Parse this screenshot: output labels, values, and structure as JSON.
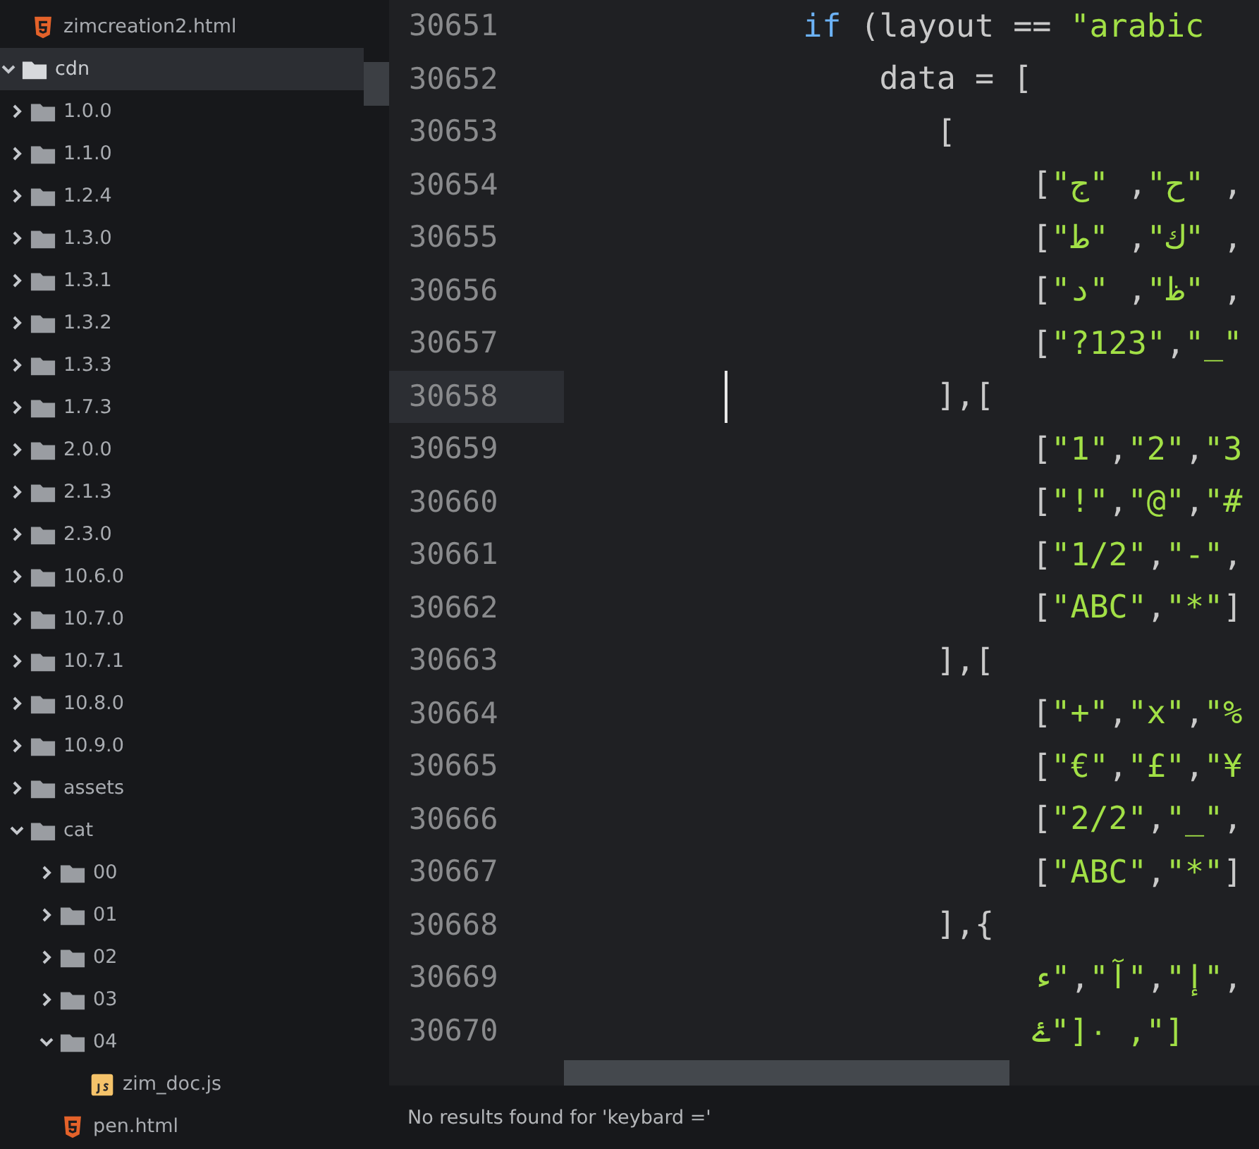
{
  "sidebar": {
    "tree": [
      {
        "children": [
          {
            "name": "zimcreation2.html",
            "kind": "html",
            "selected": false
          }
        ]
      },
      {
        "name": "cdn",
        "kind": "folder",
        "expanded": true,
        "selected": true,
        "children": [
          {
            "name": "1.0.0",
            "kind": "folder",
            "expanded": false,
            "selected": false
          },
          {
            "name": "1.1.0",
            "kind": "folder",
            "expanded": false,
            "selected": false
          },
          {
            "name": "1.2.4",
            "kind": "folder",
            "expanded": false,
            "selected": false
          },
          {
            "name": "1.3.0",
            "kind": "folder",
            "expanded": false,
            "selected": false
          },
          {
            "name": "1.3.1",
            "kind": "folder",
            "expanded": false,
            "selected": false
          },
          {
            "name": "1.3.2",
            "kind": "folder",
            "expanded": false,
            "selected": false
          },
          {
            "name": "1.3.3",
            "kind": "folder",
            "expanded": false,
            "selected": false
          },
          {
            "name": "1.7.3",
            "kind": "folder",
            "expanded": false,
            "selected": false
          },
          {
            "name": "2.0.0",
            "kind": "folder",
            "expanded": false,
            "selected": false
          },
          {
            "name": "2.1.3",
            "kind": "folder",
            "expanded": false,
            "selected": false
          },
          {
            "name": "2.3.0",
            "kind": "folder",
            "expanded": false,
            "selected": false
          },
          {
            "name": "10.6.0",
            "kind": "folder",
            "expanded": false,
            "selected": false
          },
          {
            "name": "10.7.0",
            "kind": "folder",
            "expanded": false,
            "selected": false
          },
          {
            "name": "10.7.1",
            "kind": "folder",
            "expanded": false,
            "selected": false
          },
          {
            "name": "10.8.0",
            "kind": "folder",
            "expanded": false,
            "selected": false
          },
          {
            "name": "10.9.0",
            "kind": "folder",
            "expanded": false,
            "selected": false
          },
          {
            "name": "assets",
            "kind": "folder",
            "expanded": false,
            "selected": false
          },
          {
            "name": "cat",
            "kind": "folder",
            "expanded": true,
            "selected": false,
            "children": [
              {
                "name": "00",
                "kind": "folder",
                "expanded": false,
                "selected": false
              },
              {
                "name": "01",
                "kind": "folder",
                "expanded": false,
                "selected": false
              },
              {
                "name": "02",
                "kind": "folder",
                "expanded": false,
                "selected": false
              },
              {
                "name": "03",
                "kind": "folder",
                "expanded": false,
                "selected": false
              },
              {
                "name": "04",
                "kind": "folder",
                "expanded": true,
                "selected": false,
                "children": [
                  {
                    "name": "zim_doc.js",
                    "kind": "js",
                    "selected": false
                  }
                ]
              },
              {
                "name": "pen.html",
                "kind": "html",
                "selected": false
              }
            ]
          }
        ]
      }
    ]
  },
  "editor": {
    "lines": [
      {
        "number": "30651",
        "current": false,
        "tokens": [
          {
            "kind": "keyword",
            "text": "            if"
          },
          {
            "kind": "plain",
            "text": " (layout == "
          },
          {
            "kind": "string",
            "text": "\"arabic"
          }
        ]
      },
      {
        "number": "30652",
        "current": false,
        "tokens": [
          {
            "kind": "plain",
            "text": "                data = ["
          }
        ]
      },
      {
        "number": "30653",
        "current": false,
        "tokens": [
          {
            "kind": "plain",
            "text": "                   ["
          }
        ]
      },
      {
        "number": "30654",
        "current": false,
        "tokens": [
          {
            "kind": "plain",
            "text": "                        ["
          },
          {
            "kind": "string",
            "text": "\"ج\""
          },
          {
            "kind": "plain",
            "text": " ,"
          },
          {
            "kind": "string",
            "text": "\"ح\""
          },
          {
            "kind": "plain",
            "text": " ,"
          }
        ]
      },
      {
        "number": "30655",
        "current": false,
        "tokens": [
          {
            "kind": "plain",
            "text": "                        ["
          },
          {
            "kind": "string",
            "text": "\"ط\""
          },
          {
            "kind": "plain",
            "text": " ,"
          },
          {
            "kind": "string",
            "text": "\"ك\""
          },
          {
            "kind": "plain",
            "text": " ,"
          }
        ]
      },
      {
        "number": "30656",
        "current": false,
        "tokens": [
          {
            "kind": "plain",
            "text": "                        ["
          },
          {
            "kind": "string",
            "text": "\"د\""
          },
          {
            "kind": "plain",
            "text": " ,"
          },
          {
            "kind": "string",
            "text": "\"ظ\""
          },
          {
            "kind": "plain",
            "text": " ,"
          }
        ]
      },
      {
        "number": "30657",
        "current": false,
        "tokens": [
          {
            "kind": "plain",
            "text": "                        ["
          },
          {
            "kind": "string",
            "text": "\"?123\""
          },
          {
            "kind": "plain",
            "text": ","
          },
          {
            "kind": "string",
            "text": "\"_\""
          }
        ]
      },
      {
        "number": "30658",
        "current": true,
        "tokens": [
          {
            "kind": "plain",
            "text": "                   ],["
          }
        ]
      },
      {
        "number": "30659",
        "current": false,
        "tokens": [
          {
            "kind": "plain",
            "text": "                        ["
          },
          {
            "kind": "string",
            "text": "\"1\""
          },
          {
            "kind": "plain",
            "text": ","
          },
          {
            "kind": "string",
            "text": "\"2\""
          },
          {
            "kind": "plain",
            "text": ","
          },
          {
            "kind": "string",
            "text": "\"3"
          }
        ]
      },
      {
        "number": "30660",
        "current": false,
        "tokens": [
          {
            "kind": "plain",
            "text": "                        ["
          },
          {
            "kind": "string",
            "text": "\"!\""
          },
          {
            "kind": "plain",
            "text": ","
          },
          {
            "kind": "string",
            "text": "\"@\""
          },
          {
            "kind": "plain",
            "text": ","
          },
          {
            "kind": "string",
            "text": "\"#"
          }
        ]
      },
      {
        "number": "30661",
        "current": false,
        "tokens": [
          {
            "kind": "plain",
            "text": "                        ["
          },
          {
            "kind": "string",
            "text": "\"1/2\""
          },
          {
            "kind": "plain",
            "text": ","
          },
          {
            "kind": "string",
            "text": "\"-\""
          },
          {
            "kind": "plain",
            "text": ","
          }
        ]
      },
      {
        "number": "30662",
        "current": false,
        "tokens": [
          {
            "kind": "plain",
            "text": "                        ["
          },
          {
            "kind": "string",
            "text": "\"ABC\""
          },
          {
            "kind": "plain",
            "text": ","
          },
          {
            "kind": "string",
            "text": "\"*\""
          },
          {
            "kind": "plain",
            "text": "]"
          }
        ]
      },
      {
        "number": "30663",
        "current": false,
        "tokens": [
          {
            "kind": "plain",
            "text": "                   ],["
          }
        ]
      },
      {
        "number": "30664",
        "current": false,
        "tokens": [
          {
            "kind": "plain",
            "text": "                        ["
          },
          {
            "kind": "string",
            "text": "\"+\""
          },
          {
            "kind": "plain",
            "text": ","
          },
          {
            "kind": "string",
            "text": "\"x\""
          },
          {
            "kind": "plain",
            "text": ","
          },
          {
            "kind": "string",
            "text": "\"%"
          }
        ]
      },
      {
        "number": "30665",
        "current": false,
        "tokens": [
          {
            "kind": "plain",
            "text": "                        ["
          },
          {
            "kind": "string",
            "text": "\"€\""
          },
          {
            "kind": "plain",
            "text": ","
          },
          {
            "kind": "string",
            "text": "\"£\""
          },
          {
            "kind": "plain",
            "text": ","
          },
          {
            "kind": "string",
            "text": "\"¥"
          }
        ]
      },
      {
        "number": "30666",
        "current": false,
        "tokens": [
          {
            "kind": "plain",
            "text": "                        ["
          },
          {
            "kind": "string",
            "text": "\"2/2\""
          },
          {
            "kind": "plain",
            "text": ","
          },
          {
            "kind": "string",
            "text": "\"_\""
          },
          {
            "kind": "plain",
            "text": ","
          }
        ]
      },
      {
        "number": "30667",
        "current": false,
        "tokens": [
          {
            "kind": "plain",
            "text": "                        ["
          },
          {
            "kind": "string",
            "text": "\"ABC\""
          },
          {
            "kind": "plain",
            "text": ","
          },
          {
            "kind": "string",
            "text": "\"*\""
          },
          {
            "kind": "plain",
            "text": "]"
          }
        ]
      },
      {
        "number": "30668",
        "current": false,
        "tokens": [
          {
            "kind": "plain",
            "text": "                   ],{"
          }
        ]
      },
      {
        "number": "30669",
        "current": false,
        "tokens": [
          {
            "kind": "string",
            "text": "                        ء\""
          },
          {
            "kind": "plain",
            "text": ","
          },
          {
            "kind": "string",
            "text": "\"آ\""
          },
          {
            "kind": "plain",
            "text": ","
          },
          {
            "kind": "string",
            "text": "\"إ\""
          },
          {
            "kind": "plain",
            "text": ","
          }
        ]
      },
      {
        "number": "30670",
        "current": false,
        "tokens": [
          {
            "kind": "string",
            "text": "                        ۓ\"]٠ ,\"]"
          }
        ]
      }
    ]
  },
  "status_bar": {
    "message": "No results found for 'keybard ='"
  }
}
